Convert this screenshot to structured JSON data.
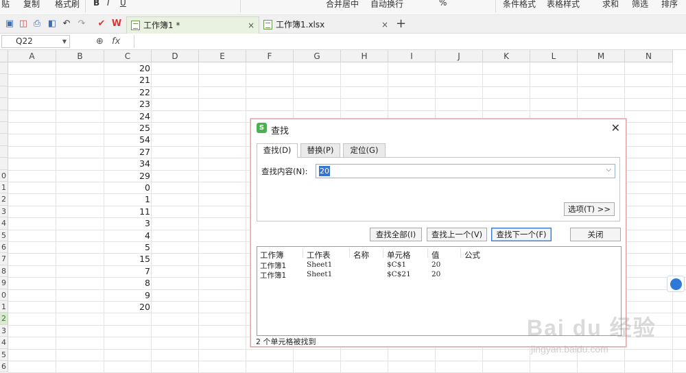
{
  "ribbon": {
    "items": [
      "贴",
      "复制",
      "格式刷",
      "B",
      "I",
      "U",
      "合并居中",
      "自动换行",
      "%",
      "条件格式",
      "表格样式",
      "求和",
      "筛选",
      "排序"
    ]
  },
  "tabs": [
    {
      "label": "工作簿1 *",
      "close": "×"
    },
    {
      "label": "工作簿1.xlsx",
      "close": "×"
    }
  ],
  "new_tab": "+",
  "formula_bar": {
    "cell_ref": "Q22",
    "fx": "fx"
  },
  "columns": [
    "A",
    "B",
    "C",
    "D",
    "E",
    "F",
    "G",
    "H",
    "I",
    "J",
    "K",
    "L",
    "M",
    "N"
  ],
  "row_numbers": [
    "",
    "",
    "",
    "",
    "",
    "",
    "",
    "",
    "",
    "0",
    "1",
    "2",
    "3",
    "4",
    "5",
    "6",
    "7",
    "8",
    "9",
    "0",
    "1",
    "2",
    "3",
    "4",
    "5",
    "6"
  ],
  "column_c_values": [
    "20",
    "21",
    "22",
    "23",
    "24",
    "25",
    "54",
    "27",
    "34",
    "29",
    "0",
    "1",
    "11",
    "3",
    "4",
    "5",
    "15",
    "7",
    "8",
    "9",
    "20"
  ],
  "dialog": {
    "logo": "S",
    "title": "查找",
    "close": "✕",
    "tabs": [
      "查找(D)",
      "替换(P)",
      "定位(G)"
    ],
    "find_label": "查找内容(N):",
    "find_value": "20",
    "options_button": "选项(T) >>",
    "buttons": {
      "find_all": "查找全部(I)",
      "find_prev": "查找上一个(V)",
      "find_next": "查找下一个(F)",
      "close": "关闭"
    },
    "results_headers": [
      "工作簿",
      "工作表",
      "名称",
      "单元格",
      "值",
      "公式"
    ],
    "results_rows": [
      [
        "工作簿1",
        "Sheet1",
        "",
        "$C$1",
        "20",
        ""
      ],
      [
        "工作簿1",
        "Sheet1",
        "",
        "$C$21",
        "20",
        ""
      ]
    ],
    "status": "2 个单元格被找到"
  },
  "watermark": {
    "big": "Bai du 经验",
    "small": "jingyan.baidu.com"
  },
  "colors": {
    "accent": "#3874d8",
    "tab_active": "#e9f2e1",
    "arrow": "#e53935",
    "row_selected": "#d9ead0"
  }
}
